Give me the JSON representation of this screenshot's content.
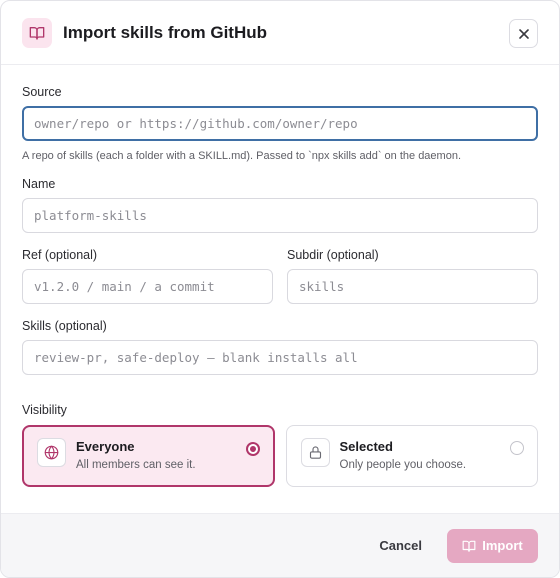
{
  "dialog": {
    "title": "Import skills from GitHub",
    "icon": "book-open-icon",
    "close_icon": "close-icon"
  },
  "form": {
    "source": {
      "label": "Source",
      "value": "",
      "placeholder": "owner/repo or https://github.com/owner/repo",
      "hint": "A repo of skills (each a folder with a SKILL.md). Passed to `npx skills add` on the daemon."
    },
    "name": {
      "label": "Name",
      "value": "",
      "placeholder": "platform-skills"
    },
    "ref": {
      "label": "Ref (optional)",
      "value": "",
      "placeholder": "v1.2.0 / main / a commit"
    },
    "subdir": {
      "label": "Subdir (optional)",
      "value": "",
      "placeholder": "skills"
    },
    "skills": {
      "label": "Skills (optional)",
      "value": "",
      "placeholder": "review-pr, safe-deploy — blank installs all"
    }
  },
  "visibility": {
    "label": "Visibility",
    "options": [
      {
        "title": "Everyone",
        "description": "All members can see it.",
        "icon": "globe-icon",
        "selected": true
      },
      {
        "title": "Selected",
        "description": "Only people you choose.",
        "icon": "lock-icon",
        "selected": false
      }
    ]
  },
  "footer": {
    "cancel_label": "Cancel",
    "import_label": "Import",
    "import_icon": "book-open-icon"
  },
  "colors": {
    "accent": "#b0366a",
    "accent_light": "#fbe9f1",
    "import_disabled": "#e5a8c2",
    "focus_border": "#3f6fa5"
  }
}
